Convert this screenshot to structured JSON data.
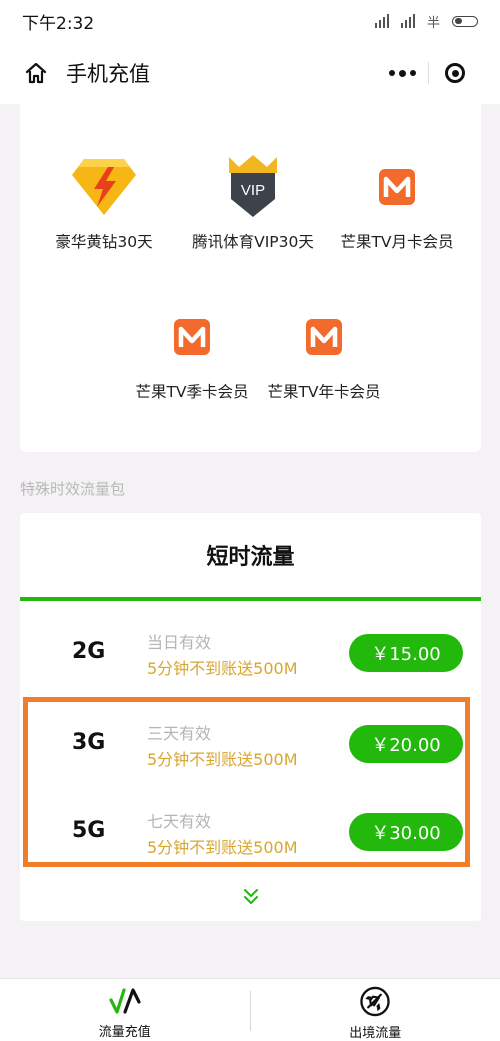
{
  "status_bar": {
    "time": "下午2:32",
    "carrier_glyph": "半"
  },
  "nav": {
    "title": "手机充值"
  },
  "vip_products": [
    {
      "label": "豪华黄钻30天",
      "icon": "yellow-diamond-icon"
    },
    {
      "label": "腾讯体育VIP30天",
      "icon": "vip-shield-icon",
      "badge": "VIP"
    },
    {
      "label": "芒果TV月卡会员",
      "icon": "mango-tv-icon"
    },
    {
      "label": "芒果TV季卡会员",
      "icon": "mango-tv-icon"
    },
    {
      "label": "芒果TV年卡会员",
      "icon": "mango-tv-icon"
    }
  ],
  "section_title": "特殊时效流量包",
  "flow_card": {
    "title": "短时流量",
    "plans": [
      {
        "name": "2G",
        "validity": "当日有效",
        "bonus": "5分钟不到账送500M",
        "price": "￥15.00"
      },
      {
        "name": "3G",
        "validity": "三天有效",
        "bonus": "5分钟不到账送500M",
        "price": "￥20.00"
      },
      {
        "name": "5G",
        "validity": "七天有效",
        "bonus": "5分钟不到账送500M",
        "price": "￥30.00"
      }
    ]
  },
  "tabs": [
    {
      "label": "流量充值",
      "icon": "flow-recharge-icon"
    },
    {
      "label": "出境流量",
      "icon": "airplane-icon"
    }
  ],
  "colors": {
    "accent_green": "#22b80c",
    "bonus_gold": "#d9a631",
    "highlight_orange": "#f07d27",
    "mango_orange": "#f26b2c"
  }
}
